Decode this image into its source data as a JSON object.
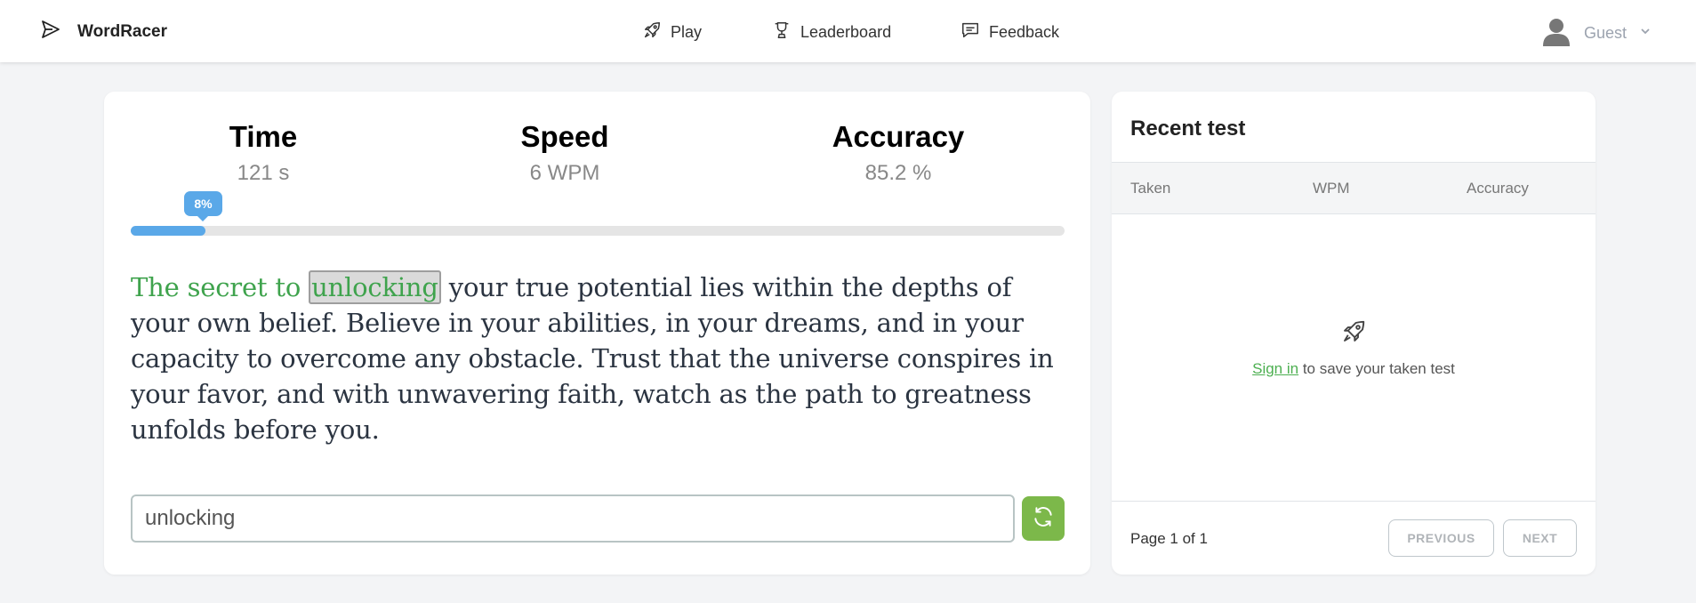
{
  "brand": {
    "name": "WordRacer"
  },
  "nav": {
    "play": "Play",
    "leaderboard": "Leaderboard",
    "feedback": "Feedback"
  },
  "user": {
    "name": "Guest"
  },
  "stats": {
    "time_label": "Time",
    "time_value": "121 s",
    "speed_label": "Speed",
    "speed_value": "6 WPM",
    "accuracy_label": "Accuracy",
    "accuracy_value": "85.2 %"
  },
  "progress": {
    "percent": 8,
    "label": "8%"
  },
  "passage": {
    "typed": "The secret to",
    "current": "unlocking",
    "remaining": "your true potential lies within the depths of your own belief. Believe in your abilities, in your dreams, and in your capacity to overcome any obstacle. Trust that the universe conspires in your favor, and with unwavering faith, watch as the path to greatness unfolds before you."
  },
  "input": {
    "value": "unlocking"
  },
  "recent": {
    "title": "Recent test",
    "columns": {
      "taken": "Taken",
      "wpm": "WPM",
      "accuracy": "Accuracy"
    },
    "empty_link": "Sign in",
    "empty_text": "to save your taken test",
    "page_info": "Page 1 of 1",
    "prev": "PREVIOUS",
    "next": "NEXT"
  },
  "colors": {
    "accent_green": "#3fa34d",
    "progress_blue": "#5aa8e8",
    "restart_green": "#7cb84a"
  }
}
